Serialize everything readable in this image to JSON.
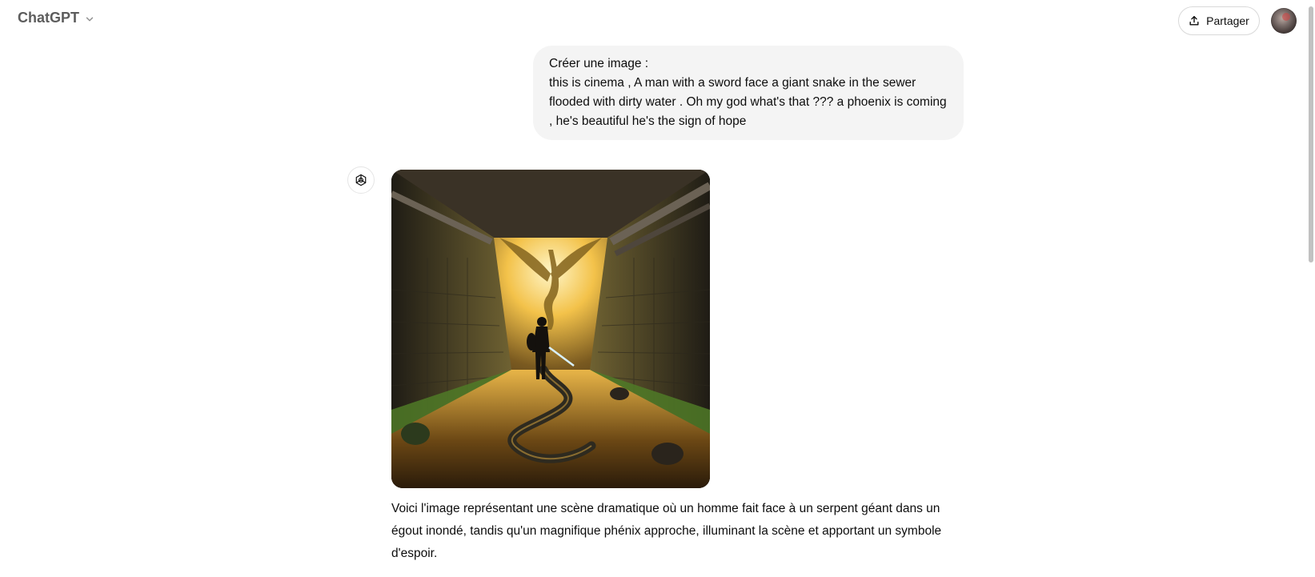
{
  "header": {
    "title": "ChatGPT",
    "share_label": "Partager",
    "chevron_icon": "chevron-down-icon",
    "share_icon": "upload-icon"
  },
  "conversation": {
    "user_message": "Créer une image :\nthis is cinema , A man with a sword face a giant snake in the sewer flooded with dirty water . Oh my god what's that ??? a phoenix is coming , he's beautiful he's the sign of hope",
    "assistant_icon": "openai-logo-icon",
    "assistant_message": "Voici l'image représentant une scène dramatique où un homme fait face à un serpent géant dans un égout inondé, tandis qu'un magnifique phénix approche, illuminant la scène et apportant un symbole d'espoir."
  },
  "colors": {
    "bubble_bg": "#f4f4f4",
    "text": "#0d0d0d",
    "muted": "#5d5d5d",
    "border": "#d9d9d9"
  }
}
